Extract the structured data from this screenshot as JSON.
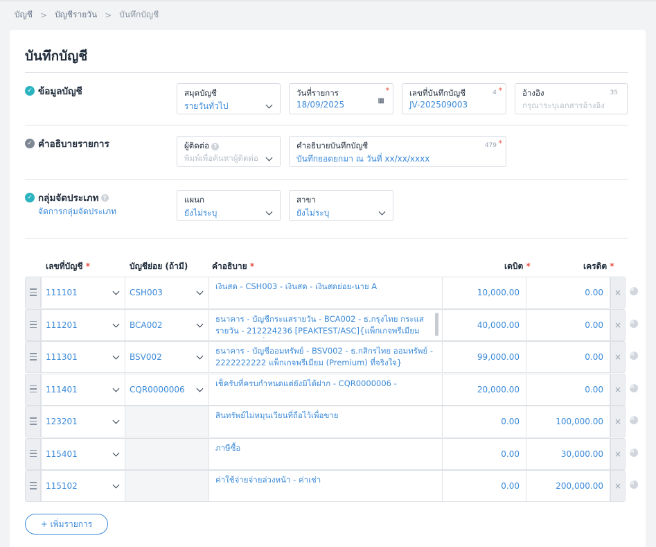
{
  "breadcrumb": {
    "items": [
      "บัญชี",
      "บัญชีรายวัน",
      "บันทึกบัญชี"
    ],
    "separator": ">"
  },
  "page_title": "บันทึกบัญชี",
  "sections": {
    "account_info": {
      "title": "ข้อมูลบัญชี",
      "journal_book": {
        "label": "สมุดบัญชี",
        "value": "รายวันทั่วไป"
      },
      "transaction_date": {
        "label": "วันที่รายการ",
        "value": "18/09/2025",
        "required": "*"
      },
      "document_number": {
        "label": "เลขที่บันทึกบัญชี",
        "value": "JV-202509003",
        "counter": "4",
        "required": "*"
      },
      "reference": {
        "label": "อ้างอิง",
        "placeholder": "กรุณาระบุเอกสารอ้างอิง",
        "counter": "35"
      }
    },
    "description": {
      "title": "คำอธิบายรายการ",
      "contact": {
        "label": "ผู้ติดต่อ",
        "placeholder": "พิมพ์เพื่อค้นหาผู้ติดต่อ"
      },
      "journal_description": {
        "label": "คำอธิบายบันทึกบัญชี",
        "value": "บันทึกยอดยกมา ณ วันที่ xx/xx/xxxx",
        "counter": "479",
        "required": "*"
      }
    },
    "classification": {
      "title": "กลุ่มจัดประเภท",
      "manage_link": "จัดการกลุ่มจัดประเภท",
      "department": {
        "label": "แผนก",
        "value": "ยังไม่ระบุ"
      },
      "branch": {
        "label": "สาขา",
        "value": "ยังไม่ระบุ"
      }
    }
  },
  "table": {
    "headers": {
      "account_no": "เลขที่บัญชี",
      "sub_account": "บัญชีย่อย (ถ้ามี)",
      "description": "คำอธิบาย",
      "debit": "เดบิต",
      "credit": "เครดิต",
      "required_mark": "*"
    },
    "rows": [
      {
        "account": "111101",
        "sub": "CSH003",
        "desc": "เงินสด - CSH003 - เงินสด - เงินสดย่อย-นาย A",
        "debit": "10,000.00",
        "credit": "0.00"
      },
      {
        "account": "111201",
        "sub": "BCA002",
        "desc": "ธนาคาร - บัญชีกระแสรายวัน - BCA002 - ธ.กรุงไทย กระแสรายวัน - 212224236 [PEAKTEST/ASC]{แพ็กเกจพรีเมียม (Premium) ที่จริงใจ}",
        "debit": "40,000.00",
        "credit": "0.00"
      },
      {
        "account": "111301",
        "sub": "BSV002",
        "desc": "ธนาคาร - บัญชีออมทรัพย์ - BSV002 - ธ.กสิกรไทย ออมทรัพย์ - 2222222222 แพ็กเกจพรีเมียม (Premium) ที่จริงใจ}",
        "debit": "99,000.00",
        "credit": "0.00"
      },
      {
        "account": "111401",
        "sub": "CQR0000006",
        "desc": "เช็ครับที่ครบกำหนดแต่ยังมิได้ฝาก - CQR0000006 -",
        "debit": "20,000.00",
        "credit": "0.00"
      },
      {
        "account": "123201",
        "sub": "",
        "desc": "สินทรัพย์ไม่หมุนเวียนที่ถือไว้เพื่อขาย",
        "debit": "0.00",
        "credit": "100,000.00"
      },
      {
        "account": "115401",
        "sub": "",
        "desc": "ภาษีซื้อ",
        "debit": "0.00",
        "credit": "30,000.00"
      },
      {
        "account": "115102",
        "sub": "",
        "desc": "ค่าใช้จ่ายจ่ายล่วงหน้า - ค่าเช่า",
        "debit": "0.00",
        "credit": "200,000.00"
      }
    ],
    "delete_symbol": "×"
  },
  "add_row_button": "+ เพิ่มรายการ",
  "colors": {
    "accent": "#3b8ad9",
    "check": "#2bb3c0",
    "required": "#e84b3c"
  }
}
